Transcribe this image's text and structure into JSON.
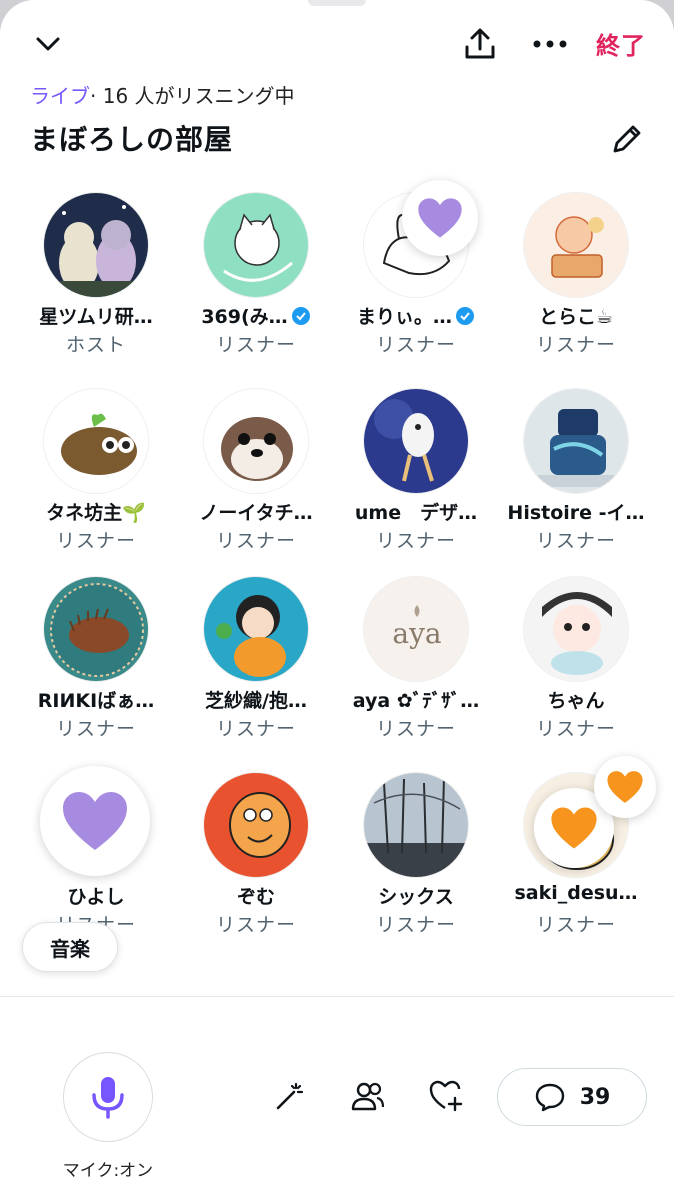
{
  "header": {
    "end_label": "終了"
  },
  "status": {
    "live": "ライブ",
    "listening": "· 16 人がリスニング中"
  },
  "room": {
    "title": "まぼろしの部屋"
  },
  "participants": [
    {
      "name": "星ツムリ研…",
      "role": "ホスト",
      "verified": false
    },
    {
      "name": "369(み…",
      "role": "リスナー",
      "verified": true
    },
    {
      "name": "まりぃ。…",
      "role": "リスナー",
      "verified": true
    },
    {
      "name": "とらこ☕",
      "role": "リスナー",
      "verified": false
    },
    {
      "name": "タネ坊主🌱",
      "role": "リスナー",
      "verified": false
    },
    {
      "name": "ノーイタチ…",
      "role": "リスナー",
      "verified": false
    },
    {
      "name": "ume　デザ…",
      "role": "リスナー",
      "verified": false
    },
    {
      "name": "Histoire -イ…",
      "role": "リスナー",
      "verified": false
    },
    {
      "name": "RIИKIばぁ…",
      "role": "リスナー",
      "verified": false
    },
    {
      "name": "芝紗織/抱…",
      "role": "リスナー",
      "verified": false
    },
    {
      "name": "aya ✿ﾞﾃﾞｻﾞ…",
      "role": "リスナー",
      "verified": false
    },
    {
      "name": "ちゃん",
      "role": "リスナー",
      "verified": false
    },
    {
      "name": "ひよし",
      "role": "リスナー",
      "verified": false
    },
    {
      "name": "ぞむ",
      "role": "リスナー",
      "verified": false
    },
    {
      "name": "シックス",
      "role": "リスナー",
      "verified": false
    },
    {
      "name": "saki_desu…",
      "role": "リスナー",
      "verified": false
    }
  ],
  "chip": {
    "label": "音楽"
  },
  "footer": {
    "mic_label": "マイク:オン",
    "comment_count": "39"
  },
  "colors": {
    "accent": "#7856ff",
    "end": "#e0245e",
    "heart_purple": "#a78be0",
    "heart_orange": "#f7941d",
    "verified": "#1d9bf0"
  },
  "icons": [
    "chevron-down-icon",
    "share-icon",
    "more-icon",
    "edit-icon",
    "heart-icon",
    "mic-icon",
    "magic-wand-icon",
    "people-icon",
    "heart-plus-icon",
    "comment-icon",
    "verified-icon"
  ]
}
